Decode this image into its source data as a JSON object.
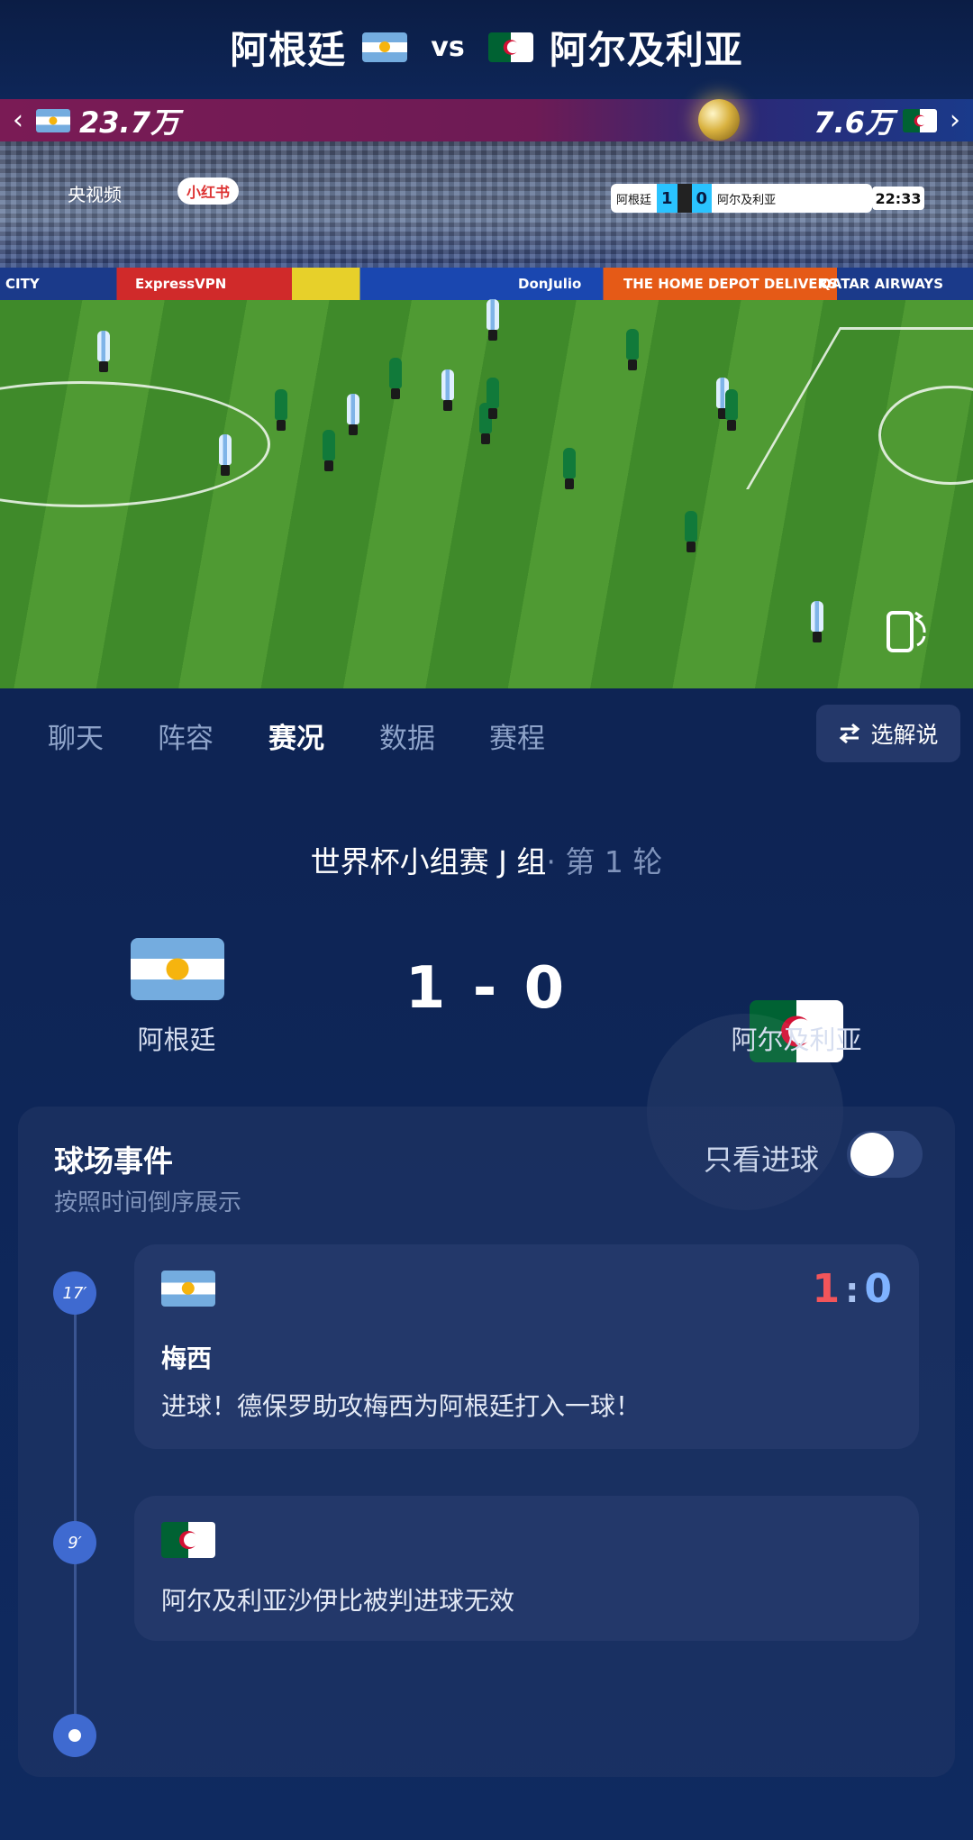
{
  "header": {
    "home_team": "阿根廷",
    "vs": "vs",
    "away_team": "阿尔及利亚"
  },
  "support_bar": {
    "home_count": "23.7万",
    "away_count": "7.6万"
  },
  "video": {
    "broadcaster": "央视频",
    "app_watermark": "小红书",
    "scorebug": {
      "home": "阿根廷",
      "home_score": "1",
      "away_score": "0",
      "away": "阿尔及利亚",
      "time": "22:33"
    },
    "ads": [
      "CITY",
      "ExpressVPN",
      "DonJulio",
      "THE HOME DEPOT DELIVERS",
      "QATAR AIRWAYS"
    ]
  },
  "tabs": [
    "聊天",
    "阵容",
    "赛况",
    "数据",
    "赛程"
  ],
  "active_tab": "赛况",
  "commentary_button": "选解说",
  "match": {
    "competition": "世界杯小组赛 J 组",
    "round": "· 第 1 轮",
    "home_name": "阿根廷",
    "away_name": "阿尔及利亚",
    "score": "1 - 0"
  },
  "events": {
    "title": "球场事件",
    "subtitle": "按照时间倒序展示",
    "goals_only_label": "只看进球",
    "goals_only_on": false,
    "items": [
      {
        "minute": "17′",
        "team": "argentina",
        "player": "梅西",
        "description": "进球！德保罗助攻梅西为阿根廷打入一球！",
        "score_home": "1",
        "score_sep": ":",
        "score_away": "0"
      },
      {
        "minute": "9′",
        "team": "algeria",
        "description": "阿尔及利亚沙伊比被判进球无效"
      }
    ]
  },
  "colors": {
    "background": "#0d2350",
    "accent_blue": "#3f6ad0",
    "score_home": "#f2555a",
    "score_away": "#7fb2ff"
  }
}
